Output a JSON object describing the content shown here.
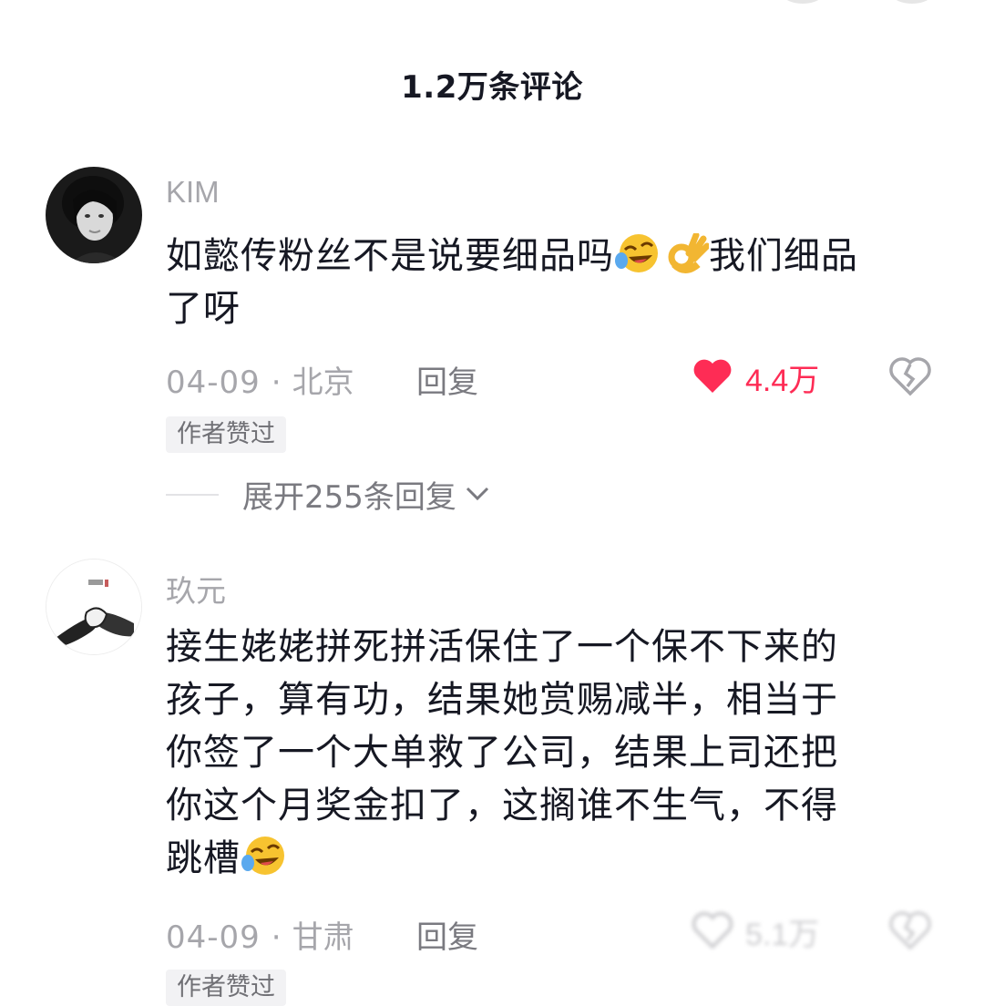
{
  "header": {
    "title": "1.2万条评论"
  },
  "comments": [
    {
      "username": "KIM",
      "text_line1": "如懿传粉丝不是说要细品吗",
      "text_line1_after": "我们细品",
      "text_line2": "了呀",
      "emojis": [
        "rolling-on-floor-laughing-emoji",
        "ok-hand-emoji"
      ],
      "date": "04-09",
      "sep": "·",
      "location": "北京",
      "reply_label": "回复",
      "like_count": "4.4万",
      "liked": true,
      "badge": "作者赞过",
      "expand_label": "展开255条回复"
    },
    {
      "username": "玖元",
      "text_lines": [
        "接生姥姥拼死拼活保住了一个保不下来的",
        "孩子，算有功，结果她赏赐减半，相当于",
        "你签了一个大单救了公司，结果上司还把",
        "你这个月奖金扣了，这搁谁不生气，不得"
      ],
      "text_last": "跳槽",
      "emojis": [
        "rolling-on-floor-laughing-emoji"
      ],
      "date": "04-09",
      "sep": "·",
      "location": "甘肃",
      "reply_label": "回复",
      "like_count": "5.1万",
      "liked": false,
      "badge": "作者赞过"
    }
  ],
  "colors": {
    "like_red": "#fe2c55",
    "muted": "#a6a6ab",
    "text": "#161823"
  }
}
